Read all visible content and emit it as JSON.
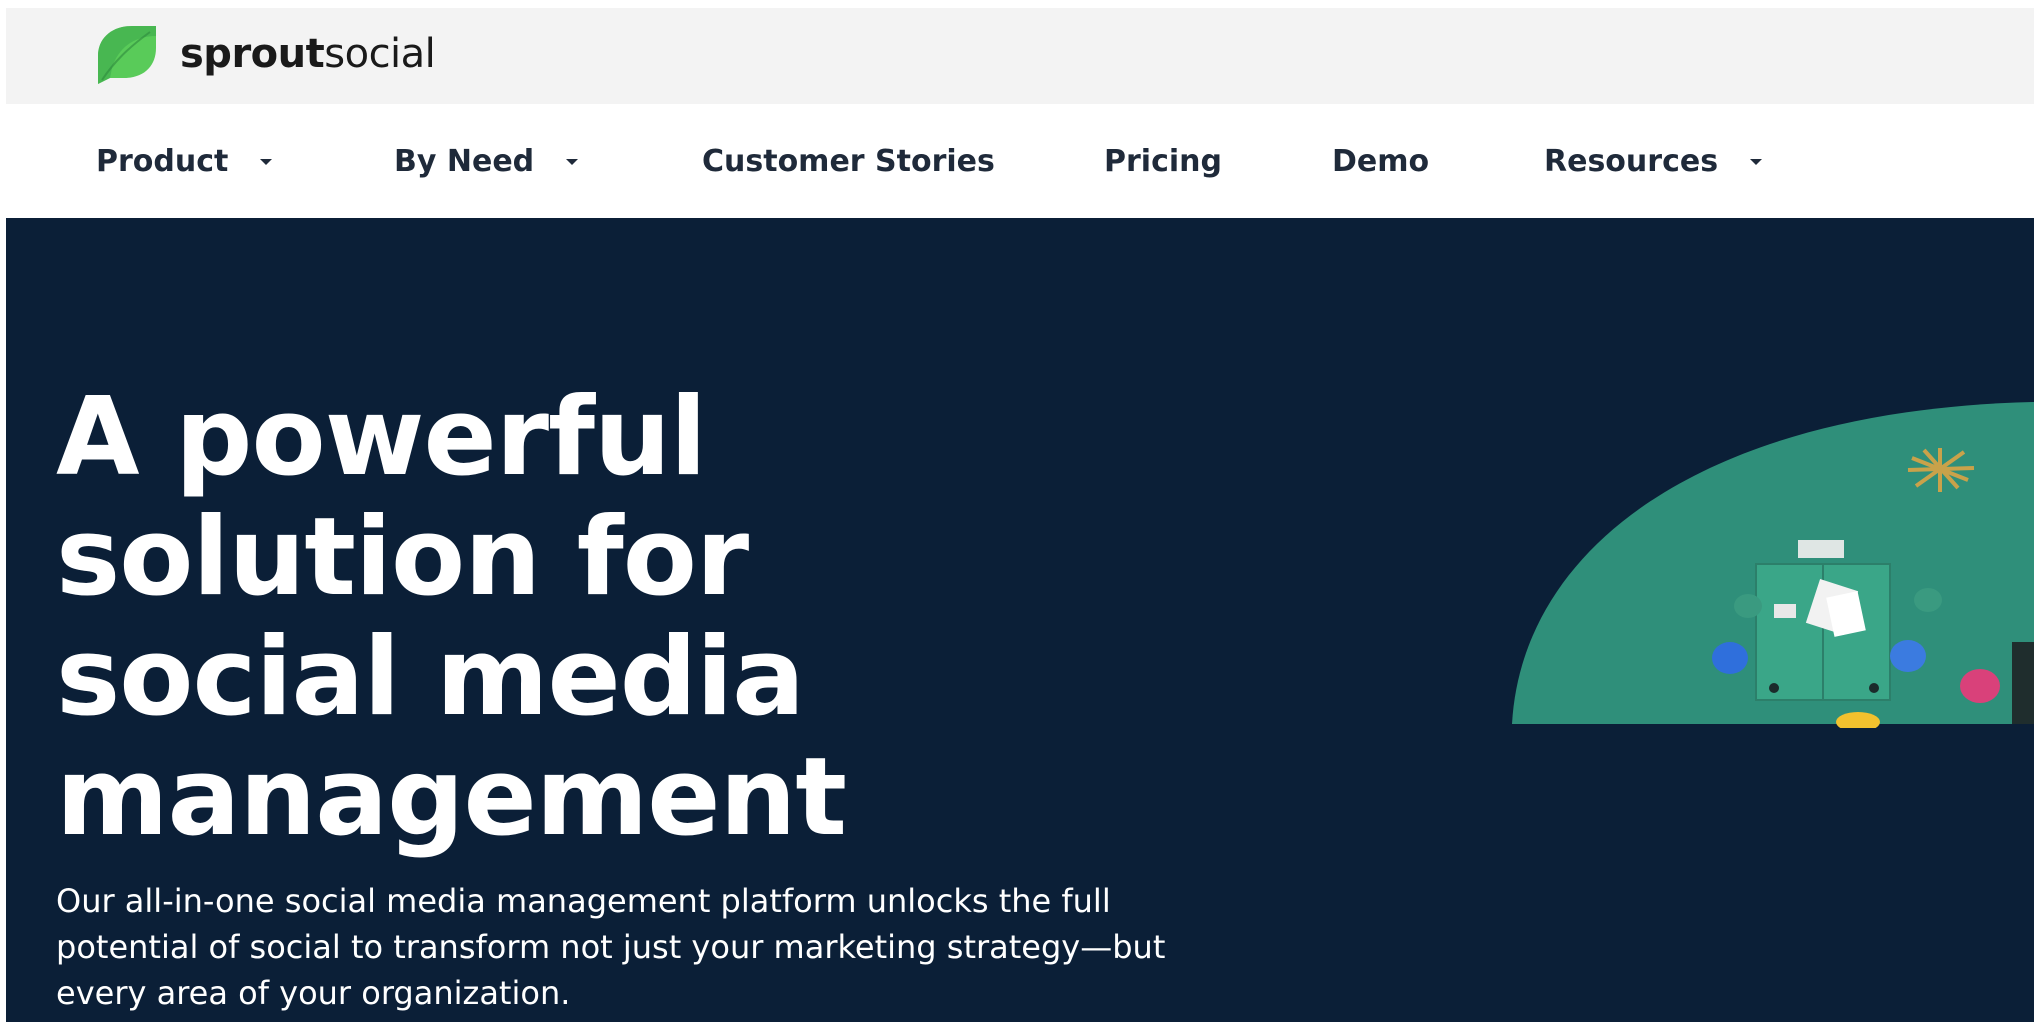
{
  "brand": {
    "name_bold": "sprout",
    "name_regular": "social",
    "accent": "#59cb59"
  },
  "nav": {
    "items": [
      {
        "label": "Product",
        "has_dropdown": true
      },
      {
        "label": "By Need",
        "has_dropdown": true
      },
      {
        "label": "Customer Stories",
        "has_dropdown": false
      },
      {
        "label": "Pricing",
        "has_dropdown": false
      },
      {
        "label": "Demo",
        "has_dropdown": false
      },
      {
        "label": "Resources",
        "has_dropdown": true
      }
    ]
  },
  "hero": {
    "background": "#0b1f37",
    "headline_lines": [
      "A powerful",
      "solution for",
      "social media",
      "management"
    ],
    "subtext": "Our all-in-one social media management platform unlocks the full potential of social to transform not just your marketing strategy—but every area of your organization.",
    "image_icon": "office-workspace-illustration"
  }
}
